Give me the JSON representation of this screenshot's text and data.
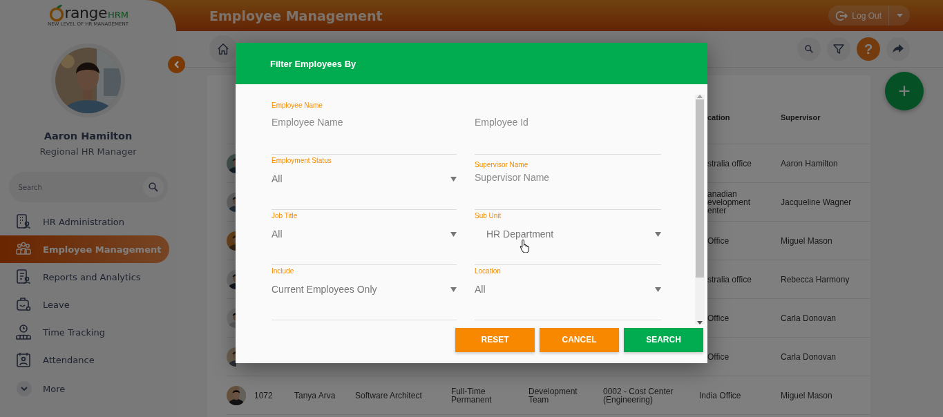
{
  "logo": {
    "text": "range",
    "accent": "HRM",
    "tagline": "NEW LEVEL OF HR MANAGEMENT"
  },
  "user": {
    "name": "Aaron Hamilton",
    "role": "Regional HR Manager"
  },
  "sidebar": {
    "search": {
      "placeholder": "Search"
    },
    "items": [
      {
        "label": "HR Administration",
        "selected": false
      },
      {
        "label": "Employee Management",
        "selected": true
      },
      {
        "label": "Reports and Analytics",
        "selected": false
      },
      {
        "label": "Leave",
        "selected": false
      },
      {
        "label": "Time Tracking",
        "selected": false
      },
      {
        "label": "Attendance",
        "selected": false
      }
    ],
    "more": "More"
  },
  "header": {
    "title": "Employee Management",
    "logout": "Log Out"
  },
  "toolbar": {
    "help": "?"
  },
  "fab": "+",
  "table": {
    "columns": [
      "cation",
      "Supervisor"
    ],
    "rows": [
      {
        "location": "stralia office",
        "supervisor": "Aaron Hamilton"
      },
      {
        "location": "anadian\nevelopment\nenter",
        "supervisor": "Jacqueline Wagner"
      },
      {
        "location": "Office",
        "supervisor": "Miguel Mason"
      },
      {
        "location": "stralia office",
        "supervisor": "Rebecca Harmony"
      },
      {
        "location": "Office",
        "supervisor": "Carla Donovan"
      },
      {
        "location": "Office",
        "supervisor": "Carla Donovan"
      },
      {
        "id": "1072",
        "name": "Tanya Arva",
        "job": "Software Architect",
        "status": "Full-Time Permanent",
        "sub_unit": "Development Team",
        "cost_center": "0002 - Cost Center (Engineering)",
        "location": "India Office",
        "supervisor": "Miguel Mason"
      }
    ]
  },
  "modal": {
    "title": "Filter Employees By",
    "fields": [
      {
        "kind": "text",
        "label": "Employee Name",
        "placeholder": "Employee Name"
      },
      {
        "kind": "text",
        "placeholder": "Employee Id"
      },
      {
        "kind": "select",
        "label": "Employment Status",
        "value": "All"
      },
      {
        "kind": "text",
        "label": "Supervisor Name",
        "placeholder": "Supervisor Name"
      },
      {
        "kind": "select",
        "label": "Job Title",
        "value": "All"
      },
      {
        "kind": "select",
        "label": "Sub Unit",
        "value": "HR Department"
      },
      {
        "kind": "select",
        "label": "Include",
        "value": "Current Employees Only"
      },
      {
        "kind": "select",
        "label": "Location",
        "value": "All"
      }
    ],
    "buttons": [
      {
        "kind": "secondary",
        "label": "RESET"
      },
      {
        "kind": "secondary",
        "label": "CANCEL"
      },
      {
        "kind": "primary",
        "label": "SEARCH"
      }
    ]
  }
}
